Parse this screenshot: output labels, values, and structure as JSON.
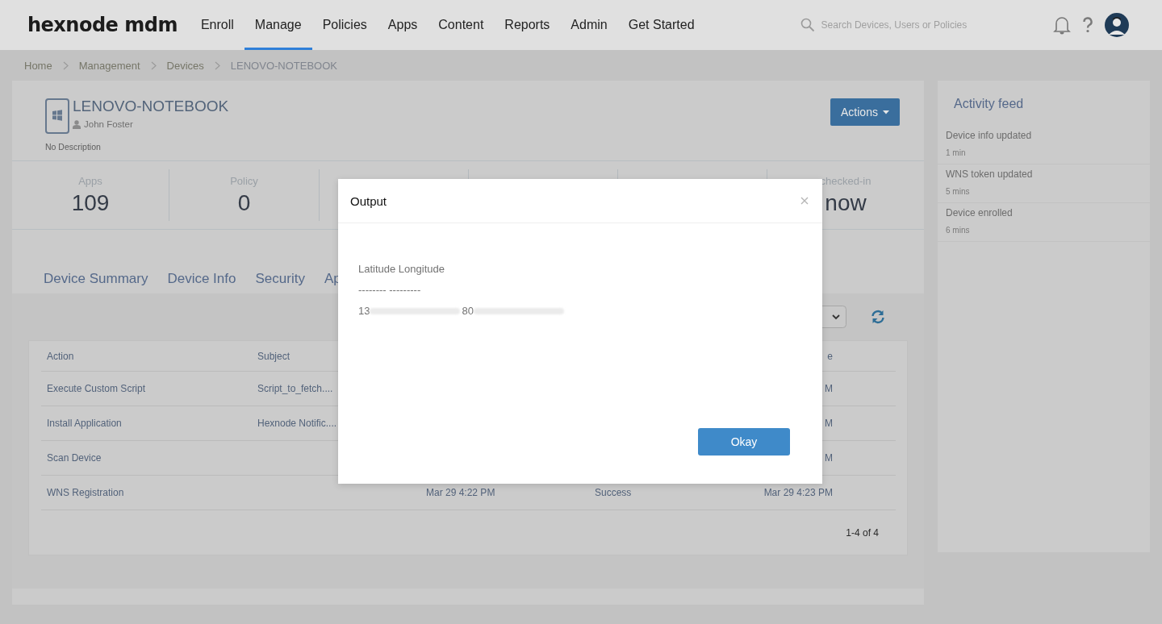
{
  "header": {
    "logo": "hexnode mdm",
    "nav": [
      {
        "label": "Enroll",
        "selected": false
      },
      {
        "label": "Manage",
        "selected": true
      },
      {
        "label": "Policies",
        "selected": false
      },
      {
        "label": "Apps",
        "selected": false
      },
      {
        "label": "Content",
        "selected": false
      },
      {
        "label": "Reports",
        "selected": false
      },
      {
        "label": "Admin",
        "selected": false
      },
      {
        "label": "Get Started",
        "selected": false
      }
    ],
    "search": {
      "placeholder": "Search Devices, Users or Policies"
    }
  },
  "breadcrumb": [
    {
      "label": "Home",
      "current": false
    },
    {
      "label": "Management",
      "current": false
    },
    {
      "label": "Devices",
      "current": false
    },
    {
      "label": "LENOVO-NOTEBOOK",
      "current": true
    }
  ],
  "device": {
    "name": "LENOVO-NOTEBOOK",
    "owner": "John Foster",
    "description": "No Description",
    "actions_button": "Actions"
  },
  "stats": [
    {
      "kind": "stat",
      "label": "Apps",
      "value": "109"
    },
    {
      "kind": "stat",
      "label": "Policy",
      "value": "0"
    },
    {
      "kind": "covered"
    },
    {
      "kind": "covered"
    },
    {
      "kind": "covered"
    },
    {
      "kind": "stat",
      "label": "checked-in",
      "value": "now"
    }
  ],
  "tabs": [
    "Device Summary",
    "Device Info",
    "Security",
    "Ap"
  ],
  "table": {
    "columns": [
      {
        "label": "Action"
      },
      {
        "label": "Subject"
      },
      {},
      {},
      {
        "label": "e"
      }
    ],
    "rows": [
      {
        "action": "Execute Custom Script",
        "subject": "Script_to_fetch....",
        "column_5": "M"
      },
      {
        "action": "Install Application",
        "subject": "Hexnode Notific....",
        "column_5": "M"
      },
      {
        "action": "Scan Device",
        "column_5": "M"
      },
      {
        "action": "WNS Registration",
        "column_3": "Mar 29 4:22 PM",
        "column_4": "Success",
        "column_5": "Mar 29 4:23 PM"
      }
    ],
    "pagination": "1-4 of 4"
  },
  "activity_feed": {
    "title": "Activity feed",
    "items": [
      {
        "text": "Device info updated",
        "time": "1 min"
      },
      {
        "text": "WNS token updated",
        "time": "5 mins"
      },
      {
        "text": "Device enrolled",
        "time": "6 mins"
      }
    ]
  },
  "modal": {
    "title": "Output",
    "lines": [
      "Latitude Longitude",
      "-------- ---------"
    ],
    "coordinates": [
      {
        "text": "13",
        "redacted": true
      },
      {
        "text": "80",
        "redacted": true
      }
    ],
    "button": "Okay"
  }
}
